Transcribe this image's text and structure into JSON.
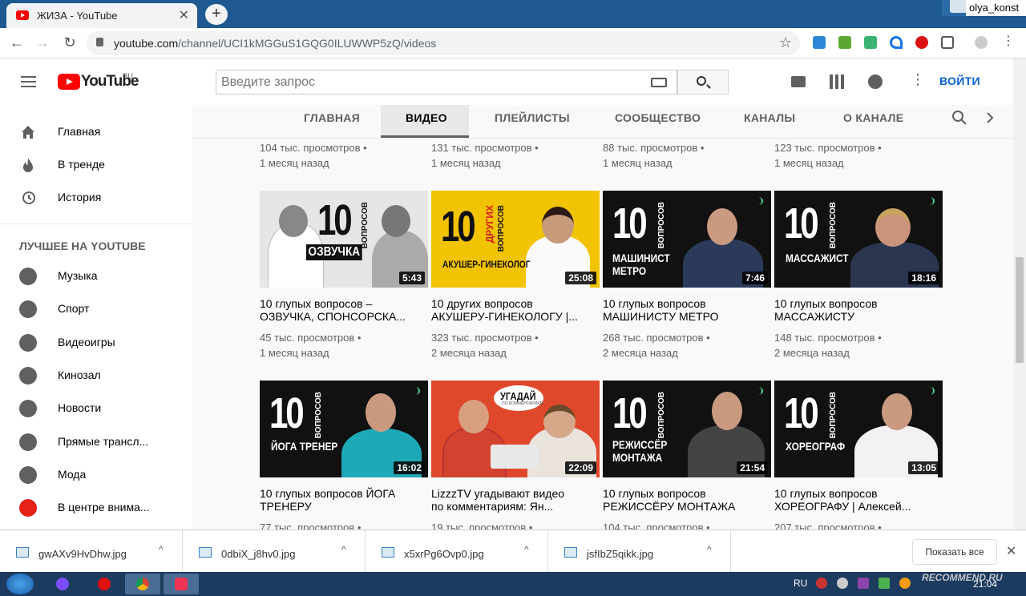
{
  "browser": {
    "tab_title": "ЖИЗА - YouTube",
    "tab_close": "✕",
    "new_tab": "+",
    "user_name": "olya_konst",
    "url_host": "youtube.com",
    "url_path": "/channel/UCI1kMGGuS1GQG0ILUWWP5zQ/videos",
    "back": "←",
    "forward": "→",
    "reload": "↻",
    "star": "☆"
  },
  "header": {
    "logo_text": "YouTube",
    "logo_region": "RU",
    "search_placeholder": "Введите запрос",
    "signin_label": "ВОЙТИ"
  },
  "sidebar": {
    "items": [
      {
        "label": "Главная",
        "icon": "home-icon"
      },
      {
        "label": "В тренде",
        "icon": "fire-icon"
      },
      {
        "label": "История",
        "icon": "history-icon"
      }
    ],
    "section_title": "ЛУЧШЕЕ НА YOUTUBE",
    "best": [
      {
        "label": "Музыка",
        "icon": "music-icon"
      },
      {
        "label": "Спорт",
        "icon": "sport-icon"
      },
      {
        "label": "Видеоигры",
        "icon": "gaming-icon"
      },
      {
        "label": "Кинозал",
        "icon": "movies-icon"
      },
      {
        "label": "Новости",
        "icon": "news-icon"
      },
      {
        "label": "Прямые трансл...",
        "icon": "live-icon"
      },
      {
        "label": "Мода",
        "icon": "fashion-icon"
      },
      {
        "label": "В центре внима...",
        "icon": "spotlight-icon"
      }
    ]
  },
  "channel_tabs": [
    "ГЛАВНАЯ",
    "ВИДЕО",
    "ПЛЕЙЛИСТЫ",
    "СООБЩЕСТВО",
    "КАНАЛЫ",
    "О КАНАЛЕ"
  ],
  "top_row": [
    {
      "views": "104 тыс. просмотров",
      "age": "1 месяц назад"
    },
    {
      "views": "131 тыс. просмотров",
      "age": "1 месяц назад"
    },
    {
      "views": "88 тыс. просмотров",
      "age": "1 месяц назад"
    },
    {
      "views": "123 тыс. просмотров",
      "age": "1 месяц назад"
    }
  ],
  "row1": [
    {
      "title1": "10 глупых вопросов –",
      "title2": " ОЗВУЧКА, СПОНСОРСКА...",
      "views": "45 тыс. просмотров",
      "age": "1 месяц назад",
      "duration": "5:43",
      "thumb_num": "10",
      "thumb_vop": "ВОПРОСОВ",
      "thumb_cap": "ОЗВУЧКА"
    },
    {
      "title1": "10 других вопросов",
      "title2": "АКУШЕРУ-ГИНЕКОЛОГУ |...",
      "views": "323 тыс. просмотров",
      "age": "2 месяца назад",
      "duration": "25:08",
      "thumb_num": "10",
      "thumb_vop": "ВОПРОСОВ",
      "thumb_vop2": "ДРУГИХ",
      "thumb_cap": "АКУШЕР-ГИНЕКОЛОГ"
    },
    {
      "title1": "10 глупых вопросов",
      "title2": "МАШИНИСТУ МЕТРО",
      "views": "268 тыс. просмотров",
      "age": "2 месяца назад",
      "duration": "7:46",
      "thumb_num": "10",
      "thumb_vop": "ВОПРОСОВ",
      "thumb_cap": "МАШИНИСТ МЕТРО"
    },
    {
      "title1": "10 глупых вопросов",
      "title2": "МАССАЖИСТУ",
      "views": "148 тыс. просмотров",
      "age": "2 месяца назад",
      "duration": "18:16",
      "thumb_num": "10",
      "thumb_vop": "ВОПРОСОВ",
      "thumb_cap": "МАССАЖИСТ"
    }
  ],
  "row2": [
    {
      "title1": "10 глупых вопросов ЙОГА",
      "title2": "ТРЕНЕРУ",
      "views": "77 тыс. просмотров",
      "duration": "16:02",
      "thumb_num": "10",
      "thumb_vop": "ВОПРОСОВ",
      "thumb_cap": "ЙОГА ТРЕНЕР"
    },
    {
      "title1": "LizzzTV угадывают видео",
      "title2": "по комментариям: Ян...",
      "views": "19 тыс. просмотров",
      "duration": "22:09",
      "thumb_cap": "УГАДАЙ",
      "thumb_sub": "ПО КОММЕНТАРИЯМ"
    },
    {
      "title1": "10 глупых вопросов",
      "title2": "РЕЖИССЁРУ МОНТАЖА",
      "views": "104 тыс. просмотров",
      "duration": "21:54",
      "thumb_num": "10",
      "thumb_vop": "ВОПРОСОВ",
      "thumb_cap": "РЕЖИССЁР МОНТАЖА"
    },
    {
      "title1": "10 глупых вопросов",
      "title2": "ХОРЕОГРАФУ | Алексей...",
      "views": "207 тыс. просмотров",
      "duration": "13:05",
      "thumb_num": "10",
      "thumb_vop": "ВОПРОСОВ",
      "thumb_cap": "ХОРЕОГРАФ"
    }
  ],
  "downloads": {
    "files": [
      "gwAXv9HvDhw.jpg",
      "0dbiX_j8hv0.jpg",
      "x5xrPg6Ovp0.jpg",
      "jsfIbZ5qikk.jpg"
    ],
    "show_all": "Показать все",
    "close": "✕",
    "chevron": "^"
  },
  "taskbar": {
    "lang": "RU",
    "clock": "21:04",
    "watermark": "RECOMMEND.RU"
  }
}
